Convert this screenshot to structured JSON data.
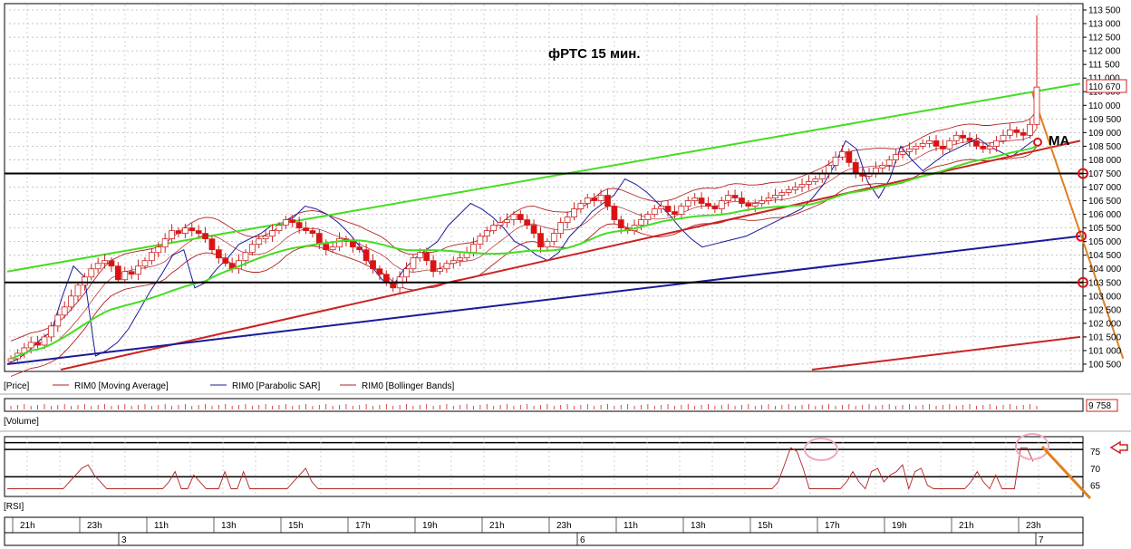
{
  "chart_data": {
    "type": "candlestick",
    "title": "фРТС   15 мин.",
    "instrument": "RIM0",
    "price_axis": {
      "ylim": [
        100300,
        113600
      ],
      "ticks": [
        100500,
        101000,
        101500,
        102000,
        102500,
        103000,
        103500,
        104000,
        104500,
        105000,
        105500,
        106000,
        106500,
        107000,
        107500,
        108000,
        108500,
        109000,
        109500,
        110000,
        110500,
        111000,
        111500,
        112000,
        112500,
        113000,
        113500
      ],
      "tick_labels": [
        "100 500",
        "101 000",
        "101 500",
        "102 000",
        "102 500",
        "103 000",
        "103 500",
        "104 000",
        "104 500",
        "105 000",
        "105 500",
        "106 000",
        "106 500",
        "107 000",
        "107 500",
        "108 000",
        "108 500",
        "109 000",
        "109 500",
        "110 000",
        "110 500",
        "111 000",
        "111 500",
        "112 000",
        "112 500",
        "113 000",
        "113 500"
      ],
      "last_price_label": "110 670",
      "last_price": 110670
    },
    "legend": {
      "price": "[Price]",
      "items": [
        {
          "name": "RIM0 [Moving Average]",
          "color": "#b22222"
        },
        {
          "name": "RIM0 [Parabolic SAR]",
          "color": "#1a1a9a"
        },
        {
          "name": "RIM0 [Bollinger Bands]",
          "color": "#b22222"
        }
      ]
    },
    "candles_close": [
      100700,
      100900,
      101100,
      101300,
      101200,
      101500,
      101900,
      102300,
      102600,
      103000,
      103400,
      103700,
      104000,
      104200,
      104300,
      104100,
      103600,
      103900,
      103800,
      104100,
      104300,
      104600,
      104800,
      105100,
      105400,
      105300,
      105500,
      105400,
      105300,
      105100,
      104700,
      104400,
      104200,
      104000,
      104300,
      104600,
      104900,
      105100,
      105200,
      105400,
      105600,
      105800,
      105700,
      105500,
      105400,
      105300,
      104900,
      104700,
      104800,
      105100,
      105000,
      104800,
      104700,
      104300,
      104000,
      103800,
      103500,
      103300,
      103700,
      104000,
      104400,
      104600,
      104300,
      103900,
      104000,
      104200,
      104300,
      104400,
      104600,
      104900,
      105200,
      105400,
      105600,
      105700,
      105800,
      106000,
      105800,
      105600,
      105300,
      104800,
      105000,
      105300,
      105700,
      105900,
      106200,
      106400,
      106600,
      106500,
      106700,
      106300,
      105800,
      105500,
      105400,
      105600,
      105800,
      106000,
      106200,
      106300,
      106100,
      106000,
      106300,
      106500,
      106600,
      106400,
      106300,
      106200,
      106500,
      106700,
      106600,
      106400,
      106300,
      106400,
      106500,
      106600,
      106700,
      106800,
      106900,
      107000,
      107100,
      107200,
      107300,
      107500,
      107800,
      108100,
      108300,
      107900,
      107500,
      107400,
      107500,
      107700,
      107800,
      108000,
      108200,
      108300,
      108400,
      108500,
      108600,
      108700,
      108500,
      108400,
      108700,
      108900,
      108800,
      108700,
      108500,
      108400,
      108500,
      108700,
      108900,
      109100,
      109000,
      108900,
      109300,
      110670
    ],
    "moving_average": {
      "name": "MA"
    },
    "parabolic_sar": [
      100500,
      100700,
      101000,
      101400,
      101700,
      103000,
      104100,
      103700,
      100800,
      101000,
      101300,
      101800,
      102500,
      103200,
      103800,
      104500,
      104700,
      103300,
      103500,
      104000,
      104400,
      104900,
      105100,
      105300,
      105600,
      105700,
      105900,
      106300,
      106200,
      106000,
      105700,
      105300,
      104800,
      104100,
      103600,
      103400,
      104000,
      104400,
      104700,
      105000,
      105600,
      106000,
      106400,
      106200,
      105900,
      105500,
      105000,
      104800,
      104500,
      104300,
      104600,
      105200,
      105600,
      106100,
      106400,
      106700,
      107300,
      107100,
      106800,
      106400,
      106000,
      105500,
      105100,
      104800,
      104900,
      105000,
      105100,
      105200,
      105400,
      105600,
      105800,
      106000,
      106200,
      106600,
      107100,
      107800,
      108700,
      108400,
      107200,
      106600,
      107300,
      108500,
      108000,
      107600,
      107900,
      108200,
      108400,
      108600,
      108800,
      108500,
      108300,
      108100,
      108400,
      108700
    ],
    "trend_lines": [
      {
        "color": "#44dd22",
        "from": [
          0,
          103900
        ],
        "to": [
          1,
          110800
        ]
      },
      {
        "color": "#cc2222",
        "from": [
          0.05,
          100300
        ],
        "to": [
          1,
          108700
        ]
      },
      {
        "color": "#1a1a9a",
        "from": [
          0,
          100500
        ],
        "to": [
          1,
          105200
        ]
      },
      {
        "color": "#cc2222",
        "from": [
          0.75,
          100300
        ],
        "to": [
          1,
          101500
        ]
      },
      {
        "color": "#e08020",
        "from": [
          0.955,
          110500
        ],
        "to": [
          1.04,
          100700
        ]
      }
    ],
    "horizontal_levels": [
      107500,
      103500
    ],
    "volume": {
      "label": "[Volume]",
      "last_value_label": "9 758"
    },
    "rsi": {
      "label": "[RSI]",
      "levels": [
        75,
        70,
        65
      ],
      "tick_labels": [
        "75",
        "70",
        "65"
      ],
      "values": [
        64,
        64,
        64,
        64,
        64,
        64,
        64,
        64,
        64,
        64,
        66,
        68,
        70,
        71,
        68,
        66,
        64,
        64,
        64,
        64,
        64,
        64,
        64,
        64,
        64,
        64,
        66,
        69,
        64,
        64,
        68,
        66,
        64,
        64,
        64,
        69,
        64,
        64,
        69,
        64,
        64,
        64,
        64,
        64,
        64,
        64,
        66,
        68,
        70,
        66,
        64,
        64,
        64,
        64,
        64,
        64,
        64,
        64,
        64,
        64,
        64,
        64,
        64,
        64,
        64,
        64,
        64,
        64,
        64,
        64,
        64,
        64,
        64,
        64,
        64,
        64,
        64,
        64,
        64,
        64,
        64,
        64,
        64,
        64,
        64,
        64,
        64,
        64,
        64,
        64,
        64,
        64,
        64,
        64,
        64,
        64,
        64,
        64,
        64,
        64,
        64,
        64,
        64,
        64,
        64,
        64,
        64,
        64,
        64,
        64,
        64,
        64,
        64,
        64,
        64,
        64,
        64,
        64,
        64,
        64,
        64,
        64,
        64,
        64,
        66,
        71,
        76,
        75,
        70,
        64,
        64,
        64,
        64,
        64,
        64,
        66,
        69,
        66,
        64,
        69,
        70,
        66,
        68,
        69,
        71,
        64,
        69,
        70,
        65,
        64,
        64,
        64,
        64,
        64,
        64,
        66,
        69,
        66,
        64,
        68,
        64,
        64,
        64,
        76,
        76,
        72
      ]
    },
    "time_axis": {
      "hour_labels": [
        "21h",
        "23h",
        "11h",
        "13h",
        "15h",
        "17h",
        "19h",
        "21h",
        "23h",
        "11h",
        "13h",
        "15h",
        "17h",
        "19h",
        "21h",
        "23h"
      ],
      "day_labels": [
        "3",
        "6",
        "7"
      ]
    }
  }
}
